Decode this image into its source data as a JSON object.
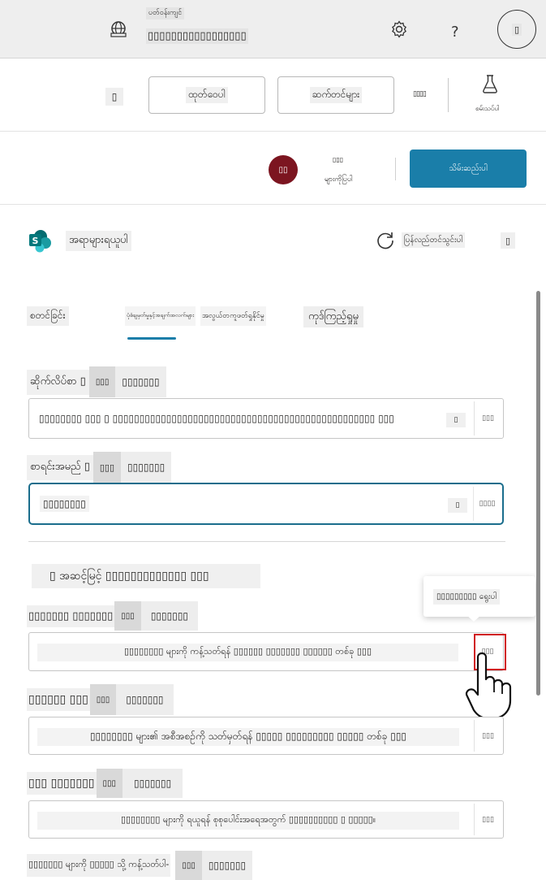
{
  "topbar": {
    "title": "ပတ်ဝန်းကျင်",
    "environment_name": "▯▯▯▯▯▯▯▯▯▯▯▯▯▯▯▯▯",
    "help_label": "?",
    "avatar_label": "▯"
  },
  "toolbar": {
    "back_label": "▯",
    "publish_label": "ထုတ်ဝေပါ",
    "settings_label": "ဆက်တင်များ",
    "more_label": "▯▯▯▯",
    "test_label": "စမ်းသပ်ပါ"
  },
  "userbar": {
    "user_initials": "▯▯",
    "user_top": "▯▯▯",
    "user_name": "များကိုပြပါ",
    "primary_label": "သိမ်းဆည်းပါ"
  },
  "panel": {
    "app_name": "အရာများရယူပါ",
    "refresh_label": "ပြန်လည်တင်သွင်းပါ",
    "close_label": "▯"
  },
  "tabs": [
    {
      "label": "စတင်ခြင်း"
    },
    {
      "label": "ပုံစံချမှတ်မှုနှင့်အချက်အလက်များ"
    },
    {
      "label": "အလွယ်တကူဖတ်ရှုနိုင်မှု"
    },
    {
      "label": "ကုဒ်ကြည့်ရှုမှု"
    }
  ],
  "fields": {
    "site": {
      "label": "ဆိုက်လိပ်စာ ▯",
      "badge1": "▯▯▯",
      "badge2": "▯▯▯▯▯▯▯",
      "value": "▯▯▯▯▯▯▯▯ ▯▯▯ ▯ ▯▯▯▯▯▯▯▯▯▯▯▯▯▯▯▯▯▯▯▯▯▯▯▯▯▯▯▯▯▯▯▯▯▯▯▯▯▯▯▯▯▯▯▯▯▯▯▯▯ ▯▯▯",
      "mini": "▯",
      "btn": "▯▯▯"
    },
    "list": {
      "label": "စာရင်းအမည် ▯",
      "badge1": "▯▯▯",
      "badge2": "▯▯▯▯▯▯▯",
      "value": "▯▯▯▯▯▯▯▯",
      "mini": "▯",
      "btn": "▯▯▯▯"
    },
    "advanced_header": "▯ အဆင့်မြင့် ▯▯▯▯▯▯▯▯▯▯▯▯▯ ▯▯▯",
    "filter": {
      "label": "▯▯▯▯▯▯▯ ▯▯▯▯▯▯▯",
      "badge1": "▯▯▯",
      "badge2": "▯▯▯▯▯▯▯",
      "value": "▯▯▯▯▯▯▯▯ များကို ကန့်သတ်ရန် ▯▯▯▯▯▯ ▯▯▯▯▯▯▯ ▯▯▯▯▯▯ တစ်ခု ▯▯▯",
      "btn": "▯▯▯"
    },
    "order": {
      "label": "▯▯▯▯▯▯ ▯▯▯",
      "badge1": "▯▯▯",
      "badge2": "▯▯▯▯▯▯▯",
      "value": "▯▯▯▯▯▯▯▯ များ၏ အစီအစဉ်ကို သတ်မှတ်ရန် ▯▯▯▯▯ ▯▯▯▯▯▯▯▯▯ ▯▯▯▯▯ တစ်ခု ▯▯▯",
      "btn": "▯▯▯"
    },
    "top": {
      "label": "▯▯▯ ▯▯▯▯▯▯▯",
      "badge1": "▯▯▯",
      "badge2": "▯▯▯▯▯▯▯",
      "value": "▯▯▯▯▯▯▯▯ များကို ရယူရန် စုစုပေါင်းအရေအတွက် ▯▯▯▯▯▯▯▯▯▯ ▯ ▯▯▯▯▯။",
      "btn": "▯▯▯"
    },
    "limit": {
      "label": "▯▯▯▯▯▯▯ များကို ▯▯▯▯▯ သို့ ကန့်သတ်ပါ-",
      "badge1": "▯▯▯",
      "badge2": "▯▯▯▯▯▯▯"
    }
  },
  "tooltip": {
    "text": "▯▯▯▯▯▯▯▯▯ ရွေးပါ"
  }
}
